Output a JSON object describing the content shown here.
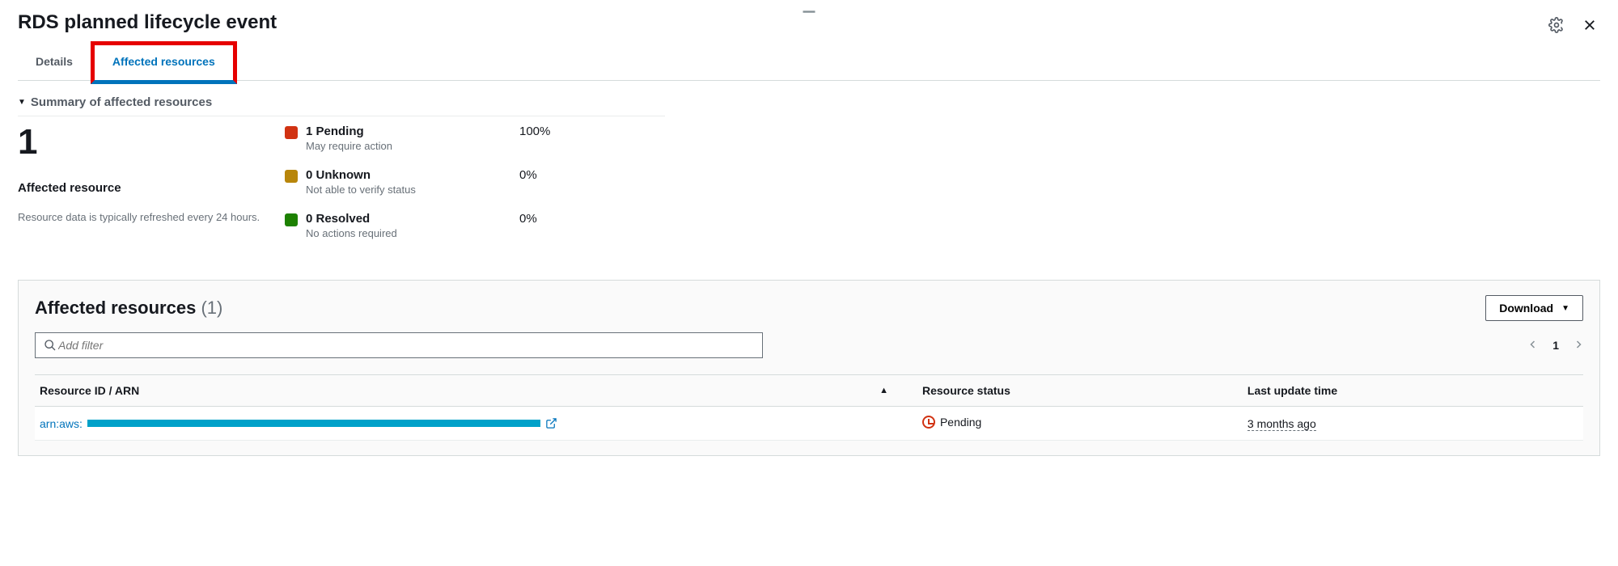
{
  "page": {
    "title": "RDS planned lifecycle event"
  },
  "tabs": {
    "details": "Details",
    "affected": "Affected resources"
  },
  "summary": {
    "heading": "Summary of affected resources",
    "big_number": "1",
    "big_label": "Affected resource",
    "refresh_note": "Resource data is typically refreshed every 24 hours.",
    "statuses": [
      {
        "label": "1 Pending",
        "desc": "May require action",
        "pct": "100%"
      },
      {
        "label": "0 Unknown",
        "desc": "Not able to verify status",
        "pct": "0%"
      },
      {
        "label": "0 Resolved",
        "desc": "No actions required",
        "pct": "0%"
      }
    ]
  },
  "table": {
    "title": "Affected resources",
    "count": "(1)",
    "download": "Download",
    "filter_placeholder": "Add filter",
    "page_current": "1",
    "columns": {
      "resource": "Resource ID / ARN",
      "status": "Resource status",
      "updated": "Last update time"
    },
    "rows": [
      {
        "arn_prefix": "arn:aws:",
        "status": "Pending",
        "updated": "3 months ago"
      }
    ]
  }
}
